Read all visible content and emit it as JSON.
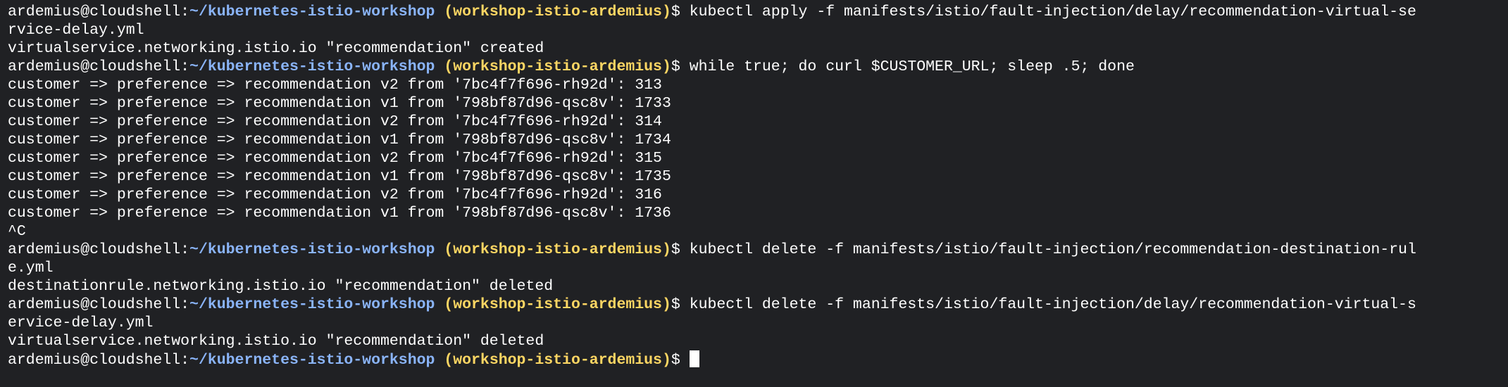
{
  "prompt": {
    "user_host": "ardemius@cloudshell:",
    "path": "~/kubernetes-istio-workshop",
    "project": "(workshop-istio-ardemius)",
    "symbol": "$"
  },
  "lines": [
    {
      "type": "prompt",
      "command": "kubectl apply -f manifests/istio/fault-injection/delay/recommendation-virtual-se"
    },
    {
      "type": "output",
      "text": "rvice-delay.yml"
    },
    {
      "type": "output",
      "text": "virtualservice.networking.istio.io \"recommendation\" created"
    },
    {
      "type": "prompt",
      "command": "while true; do curl $CUSTOMER_URL; sleep .5; done"
    },
    {
      "type": "output",
      "text": "customer => preference => recommendation v2 from '7bc4f7f696-rh92d': 313"
    },
    {
      "type": "output",
      "text": "customer => preference => recommendation v1 from '798bf87d96-qsc8v': 1733"
    },
    {
      "type": "output",
      "text": "customer => preference => recommendation v2 from '7bc4f7f696-rh92d': 314"
    },
    {
      "type": "output",
      "text": "customer => preference => recommendation v1 from '798bf87d96-qsc8v': 1734"
    },
    {
      "type": "output",
      "text": "customer => preference => recommendation v2 from '7bc4f7f696-rh92d': 315"
    },
    {
      "type": "output",
      "text": "customer => preference => recommendation v1 from '798bf87d96-qsc8v': 1735"
    },
    {
      "type": "output",
      "text": "customer => preference => recommendation v2 from '7bc4f7f696-rh92d': 316"
    },
    {
      "type": "output",
      "text": "customer => preference => recommendation v1 from '798bf87d96-qsc8v': 1736"
    },
    {
      "type": "output",
      "text": "^C"
    },
    {
      "type": "prompt",
      "command": "kubectl delete -f manifests/istio/fault-injection/recommendation-destination-rul"
    },
    {
      "type": "output",
      "text": "e.yml"
    },
    {
      "type": "output",
      "text": "destinationrule.networking.istio.io \"recommendation\" deleted"
    },
    {
      "type": "prompt",
      "command": "kubectl delete -f manifests/istio/fault-injection/delay/recommendation-virtual-s"
    },
    {
      "type": "output",
      "text": "ervice-delay.yml"
    },
    {
      "type": "output",
      "text": "virtualservice.networking.istio.io \"recommendation\" deleted"
    },
    {
      "type": "prompt",
      "command": "",
      "cursor": true
    }
  ],
  "colors": {
    "background": "#202124",
    "text": "#ffffff",
    "path": "#8ab4f8",
    "project": "#fdd663"
  }
}
